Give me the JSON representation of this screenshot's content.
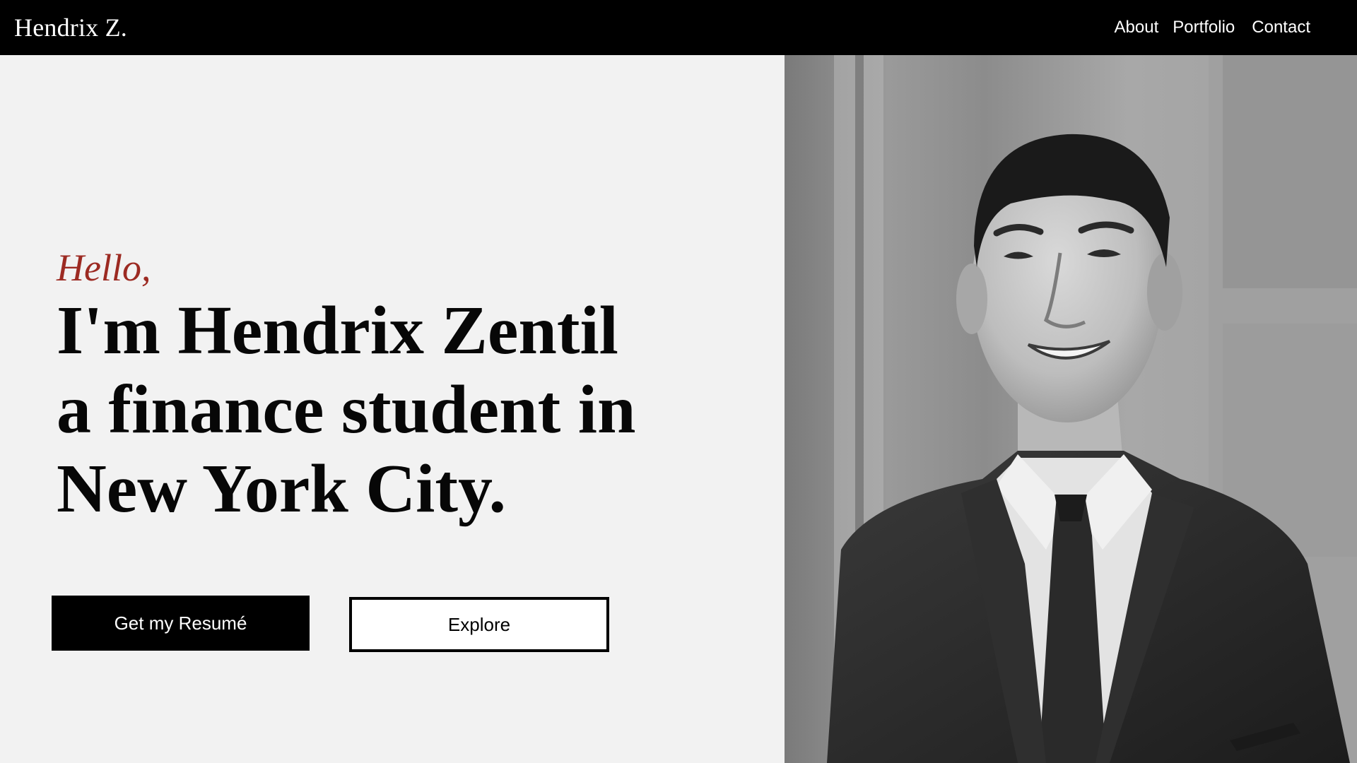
{
  "navbar": {
    "brand": "Hendrix Z.",
    "links": [
      {
        "label": "About"
      },
      {
        "label": "Portfolio"
      },
      {
        "label": "Contact"
      }
    ]
  },
  "hero": {
    "greeting": "Hello,",
    "headline_lines": [
      "I'm Hendrix Zentil",
      "a finance student in",
      "New York City."
    ],
    "primary_button": "Get my Resumé",
    "secondary_button": "Explore"
  },
  "colors": {
    "navbar_bg": "#000000",
    "page_bg": "#f2f2f2",
    "greeting": "#9c2a22",
    "headline": "#070707"
  },
  "photo": {
    "style": "black-and-white portrait"
  }
}
